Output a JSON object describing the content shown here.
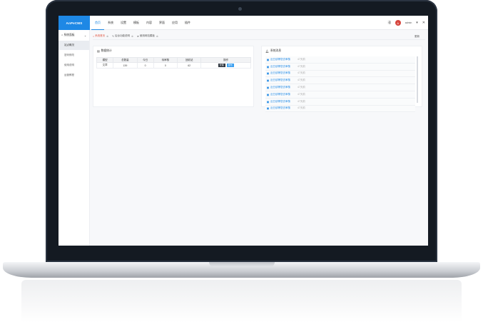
{
  "app": {
    "brand": "AnPeCMS"
  },
  "topnav": [
    {
      "label": "首页",
      "active": true
    },
    {
      "label": "系统",
      "active": false
    },
    {
      "label": "设置",
      "active": false
    },
    {
      "label": "模板",
      "active": false
    },
    {
      "label": "内容",
      "active": false
    },
    {
      "label": "界面",
      "active": false
    },
    {
      "label": "应用",
      "active": false
    },
    {
      "label": "插件",
      "active": false
    }
  ],
  "header": {
    "user_name": "admin",
    "avatar_text": "A"
  },
  "sidebar": {
    "title": "系统面板",
    "items": [
      {
        "label": "站点概况",
        "active": true
      },
      {
        "label": "密码修改",
        "active": false
      },
      {
        "label": "使用说明",
        "active": false
      },
      {
        "label": "运营教程",
        "active": false
      }
    ]
  },
  "tabs": [
    {
      "label": "系统首页",
      "active": true
    },
    {
      "label": "后台功能说明",
      "active": false
    },
    {
      "label": "使用网站模板",
      "active": false
    }
  ],
  "tab_right": "更新",
  "stats": {
    "title": "数据统计",
    "headers": [
      "模型",
      "总数量",
      "今日",
      "待审核",
      "回收站",
      "操作"
    ],
    "row": [
      "文章",
      "139",
      "0",
      "0",
      "62"
    ],
    "actions": [
      "管理",
      "发布"
    ]
  },
  "messages": {
    "title": "系统消息",
    "items": [
      {
        "title": "近日该等您去审核",
        "date": "47天前"
      },
      {
        "title": "近日该等您去审核",
        "date": "47天前"
      },
      {
        "title": "近日该等您去审核",
        "date": "47天前"
      },
      {
        "title": "近日该等您去审核",
        "date": "47天前"
      },
      {
        "title": "近日该等您去审核",
        "date": "47天前"
      },
      {
        "title": "近日该等您去审核",
        "date": "47天前"
      },
      {
        "title": "近日该等您去审核",
        "date": "47天前"
      },
      {
        "title": "近日该等您去审核",
        "date": "47天前"
      }
    ]
  },
  "colors": {
    "accent": "#1e88e5",
    "active_tab": "#e0533f"
  }
}
